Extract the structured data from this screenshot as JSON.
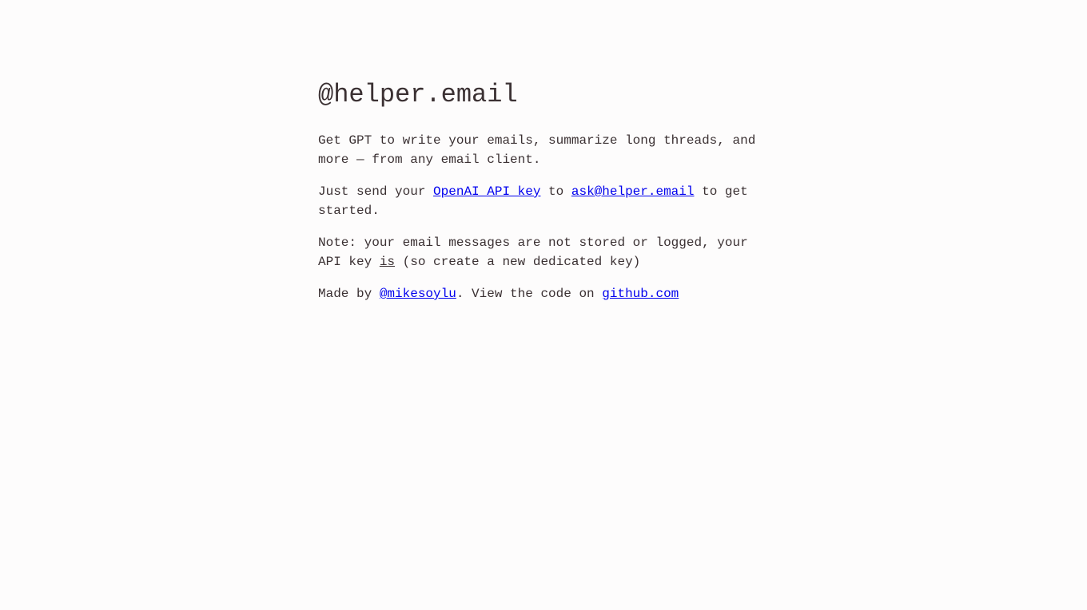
{
  "title": "@helper.email",
  "intro": "Get GPT to write your emails, summarize long threads, and more — from any email client.",
  "instructions": {
    "prefix": "Just send your ",
    "api_key_link": "OpenAI API key",
    "middle": " to ",
    "email_link": "ask@helper.email",
    "suffix": " to get started."
  },
  "note": {
    "prefix": "Note: your email messages are not stored or logged, your API key ",
    "emphasis": "is",
    "suffix": " (so create a new dedicated key)"
  },
  "footer": {
    "prefix": "Made by ",
    "author_link": "@mikesoylu",
    "middle": ". View the code on ",
    "code_link": "github.com"
  },
  "colors": {
    "text": "#3b3133",
    "link": "#0000ee",
    "background": "#fdfcfc"
  }
}
